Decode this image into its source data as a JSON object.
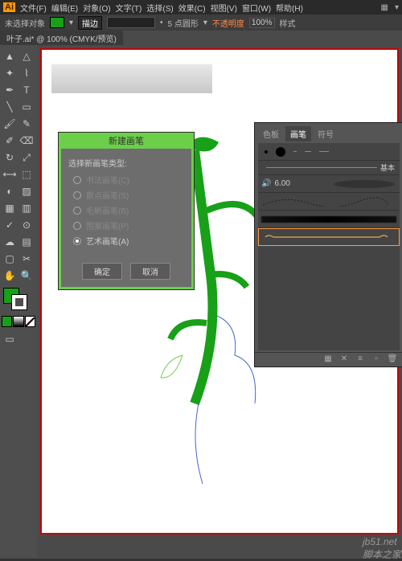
{
  "menu": {
    "file": "文件(F)",
    "edit": "编辑(E)",
    "object": "对象(O)",
    "type": "文字(T)",
    "select": "选择(S)",
    "effect": "效果(C)",
    "view": "视图(V)",
    "window": "窗口(W)",
    "help": "帮助(H)"
  },
  "ctrlbar": {
    "noselect": "未选择对象",
    "desc_btn": "描边",
    "brush_label": "5 点圆形",
    "opacity_label": "不透明度",
    "opacity_val": "100%",
    "style": "样式"
  },
  "tab": {
    "name": "叶子.ai* @ 100% (CMYK/预览)"
  },
  "dialog": {
    "title": "新建画笔",
    "label": "选择新画笔类型:",
    "opt1": "书法画笔(C)",
    "opt2": "散点画笔(S)",
    "opt3": "毛刷画笔(B)",
    "opt4": "图案画笔(P)",
    "opt5": "艺术画笔(A)",
    "ok": "确定",
    "cancel": "取消"
  },
  "panel": {
    "tab1": "色板",
    "tab2": "画笔",
    "tab3": "符号",
    "basic": "基本",
    "sizeval": "6.00"
  },
  "watermark": {
    "site": "jb51.net",
    "name": "脚本之家"
  }
}
